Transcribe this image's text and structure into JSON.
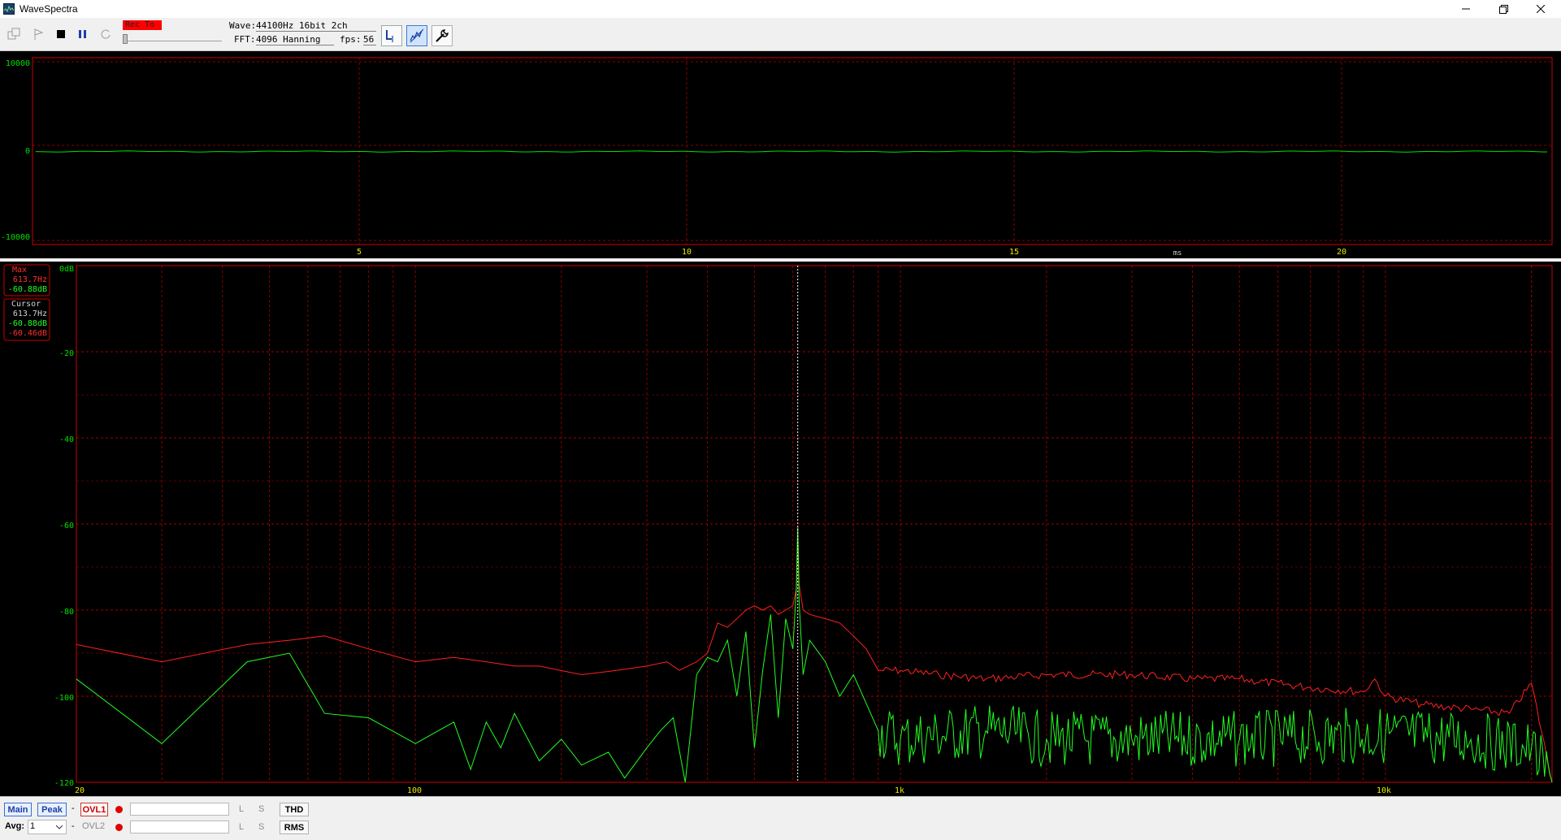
{
  "window": {
    "title": "WaveSpectra"
  },
  "toolbar": {
    "rec_badge": "Rec To",
    "wave_label": "Wave:",
    "wave_value": "44100Hz 16bit 2ch",
    "fft_label": "FFT:",
    "fft_value": "4096 Hanning",
    "fps_label": "fps:",
    "fps_value": "56"
  },
  "wave_plot": {
    "y_ticks": [
      "10000",
      "0",
      "-10000"
    ],
    "x_ticks": [
      "5",
      "10",
      "15",
      "20"
    ],
    "x_unit": "ms",
    "trace_color": "#00ff00",
    "frame_color": "#cc0000"
  },
  "spectrum_plot": {
    "y_ticks": [
      "0dB",
      "-20",
      "-40",
      "-60",
      "-80",
      "-100",
      "-120"
    ],
    "x_ticks": [
      "20",
      "100",
      "1k",
      "10k"
    ],
    "max_box": {
      "label": "Max",
      "freq": "613.7Hz",
      "level": "-60.88dB"
    },
    "cursor_box": {
      "label": "Cursor",
      "freq": "613.7Hz",
      "level_green": "-60.88dB",
      "level_red": "-60.46dB"
    },
    "peak_color": "#ff2020",
    "live_color": "#20ff20"
  },
  "bottom": {
    "main_label": "Main",
    "peak_label": "Peak",
    "dash1": "-",
    "ovl1_label": "OVL1",
    "avg_label": "Avg:",
    "avg_value": "1",
    "dash2": "-",
    "ovl2_label": "OVL2",
    "l1": "L",
    "s1": "S",
    "l2": "L",
    "s2": "S",
    "thd_label": "THD",
    "rms_label": "RMS"
  },
  "chart_data": {
    "type": "line",
    "x_scale": "log",
    "xlim": [
      20,
      22050
    ],
    "ylim": [
      -120,
      0
    ],
    "ylabel": "dB",
    "series": [
      {
        "x": [
          20,
          30,
          45,
          55,
          65,
          80,
          100,
          120,
          140,
          160,
          180,
          220,
          260,
          300,
          330,
          350,
          380,
          400,
          420,
          440,
          460,
          480,
          500,
          520,
          540,
          560,
          580,
          600,
          610,
          614,
          618,
          630,
          650,
          700,
          750,
          800,
          850,
          900,
          1000,
          1200,
          1500,
          2000,
          3000,
          4000,
          5000,
          7000,
          9000,
          9500,
          10000,
          12000,
          15000,
          18000,
          20000,
          22050
        ],
        "y": [
          -88,
          -92,
          -88,
          -87,
          -86,
          -89,
          -92,
          -91,
          -92,
          -93,
          -93,
          -95,
          -94,
          -93,
          -92,
          -94,
          -92,
          -90,
          -83,
          -84,
          -82,
          -80,
          -79,
          -80,
          -79,
          -81,
          -80,
          -79,
          -75,
          -60.5,
          -74,
          -80,
          -81,
          -82,
          -83,
          -86,
          -89,
          -94,
          -94,
          -95,
          -96,
          -95,
          -95,
          -96,
          -96,
          -98,
          -99,
          -96,
          -100,
          -102,
          -103,
          -104,
          -97,
          -120
        ]
      },
      {
        "x": [
          20,
          30,
          45,
          55,
          65,
          80,
          100,
          120,
          130,
          140,
          150,
          160,
          180,
          200,
          220,
          250,
          270,
          300,
          320,
          340,
          360,
          380,
          400,
          420,
          440,
          460,
          480,
          500,
          520,
          540,
          560,
          580,
          600,
          610,
          614,
          618,
          630,
          650,
          700,
          750,
          800,
          900,
          1000,
          1500,
          2000,
          3000,
          5000,
          10000,
          15000,
          20000,
          22050
        ],
        "y": [
          -96,
          -111,
          -92,
          -90,
          -104,
          -105,
          -111,
          -106,
          -117,
          -106,
          -112,
          -104,
          -115,
          -110,
          -116,
          -113,
          -119,
          -112,
          -108,
          -105,
          -120,
          -95,
          -91,
          -92,
          -87,
          -100,
          -85,
          -112,
          -94,
          -81,
          -105,
          -82,
          -89,
          -75,
          -60.9,
          -78,
          -95,
          -87,
          -92,
          -100,
          -95,
          -108,
          -110,
          -108,
          -110,
          -110,
          -110,
          -109,
          -110,
          -112,
          -120
        ]
      }
    ]
  }
}
